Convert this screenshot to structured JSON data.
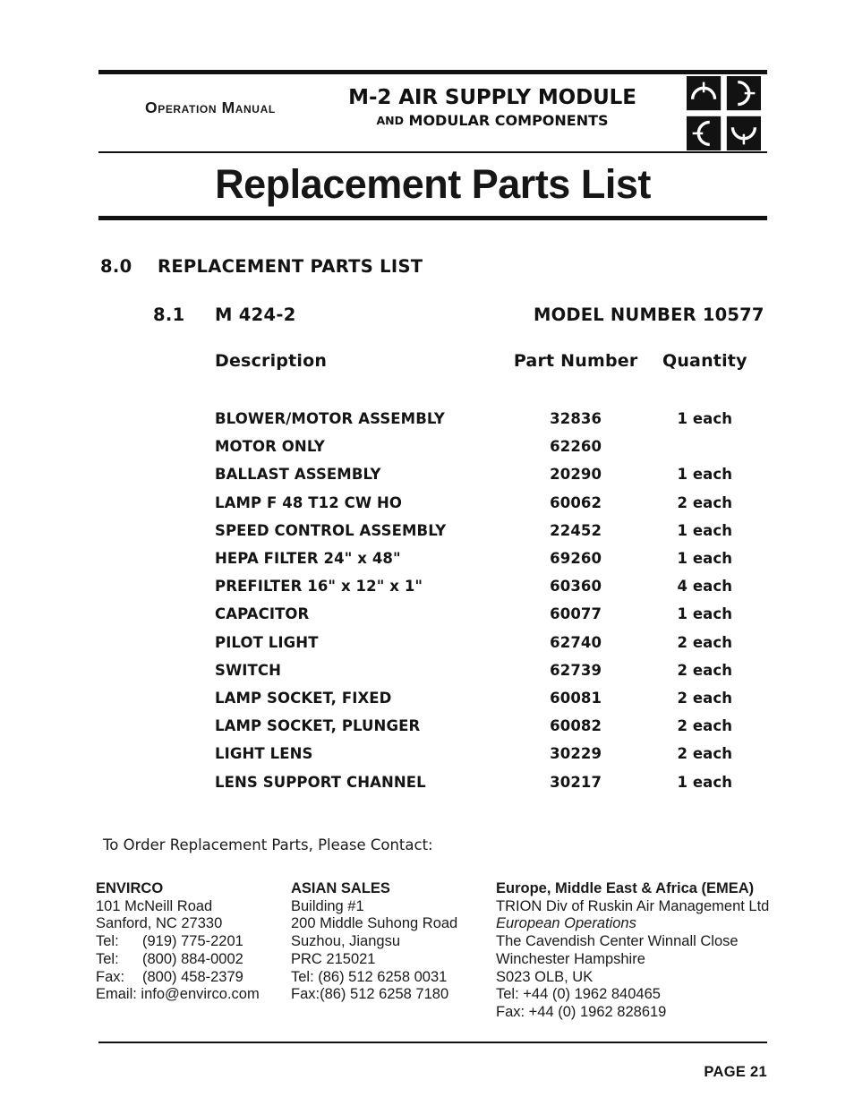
{
  "header": {
    "left_label": "Operation Manual",
    "title": "M-2 AIR SUPPLY MODULE",
    "subtitle_and": "AND",
    "subtitle_rest": "MODULAR COMPONENTS",
    "logo_name": "envirco-quadrant-logo"
  },
  "page_heading": "Replacement Parts List",
  "sections": {
    "s80_number": "8.0",
    "s80_title": "REPLACEMENT PARTS LIST",
    "s81_number": "8.1",
    "s81_title": "M 424-2",
    "model_number": "MODEL NUMBER 10577"
  },
  "table": {
    "headers": {
      "description": "Description",
      "part_number": "Part Number",
      "quantity": "Quantity"
    },
    "rows": [
      {
        "description": "BLOWER/MOTOR ASSEMBLY",
        "part_number": "32836",
        "quantity": "1 each"
      },
      {
        "description": "MOTOR ONLY",
        "part_number": "62260",
        "quantity": ""
      },
      {
        "description": "BALLAST ASSEMBLY",
        "part_number": "20290",
        "quantity": "1 each"
      },
      {
        "description": "LAMP  F 48 T12 CW HO",
        "part_number": "60062",
        "quantity": "2 each"
      },
      {
        "description": "SPEED CONTROL ASSEMBLY",
        "part_number": "22452",
        "quantity": "1 each"
      },
      {
        "description": "HEPA FILTER  24\" x 48\"",
        "part_number": "69260",
        "quantity": "1 each"
      },
      {
        "description": "PREFILTER   16\" x 12\" x 1\"",
        "part_number": "60360",
        "quantity": "4 each"
      },
      {
        "description": "CAPACITOR",
        "part_number": "60077",
        "quantity": "1 each"
      },
      {
        "description": "PILOT LIGHT",
        "part_number": "62740",
        "quantity": "2 each"
      },
      {
        "description": "SWITCH",
        "part_number": "62739",
        "quantity": "2 each"
      },
      {
        "description": "LAMP SOCKET, FIXED",
        "part_number": "60081",
        "quantity": "2 each"
      },
      {
        "description": "LAMP SOCKET, PLUNGER",
        "part_number": "60082",
        "quantity": "2 each"
      },
      {
        "description": "LIGHT LENS",
        "part_number": "30229",
        "quantity": "2 each"
      },
      {
        "description": "LENS SUPPORT CHANNEL",
        "part_number": "30217",
        "quantity": "1 each"
      }
    ]
  },
  "order_note": "To Order Replacement Parts, Please Contact:",
  "contacts": [
    {
      "heading": "ENVIRCO",
      "lines": [
        "101 McNeill Road",
        "Sanford, NC 27330"
      ],
      "labeled_lines": [
        {
          "label": "Tel:",
          "value": "(919) 775-2201"
        },
        {
          "label": "Tel:",
          "value": "(800) 884-0002"
        },
        {
          "label": "Fax:",
          "value": "(800) 458-2379"
        }
      ],
      "email_line": "Email: info@envirco.com"
    },
    {
      "heading": "ASIAN SALES",
      "lines": [
        "Building #1",
        "200 Middle Suhong Road",
        "Suzhou, Jiangsu",
        "PRC 215021",
        "Tel: (86) 512 6258 0031",
        "Fax:(86) 512 6258 7180"
      ]
    },
    {
      "heading": "Europe, Middle East & Africa (EMEA)",
      "line_plain_1": "TRION Div of Ruskin Air Management Ltd",
      "line_italic": "European Operations",
      "lines": [
        "The Cavendish Center Winnall Close",
        "Winchester Hampshire",
        "S023 OLB, UK",
        "Tel: +44 (0) 1962 840465",
        "Fax: +44 (0) 1962 828619"
      ]
    }
  ],
  "footer": {
    "page_label": "PAGE 21"
  },
  "colors": {
    "ink": "#1a1a1a",
    "rule": "#111111",
    "background": "#ffffff"
  }
}
